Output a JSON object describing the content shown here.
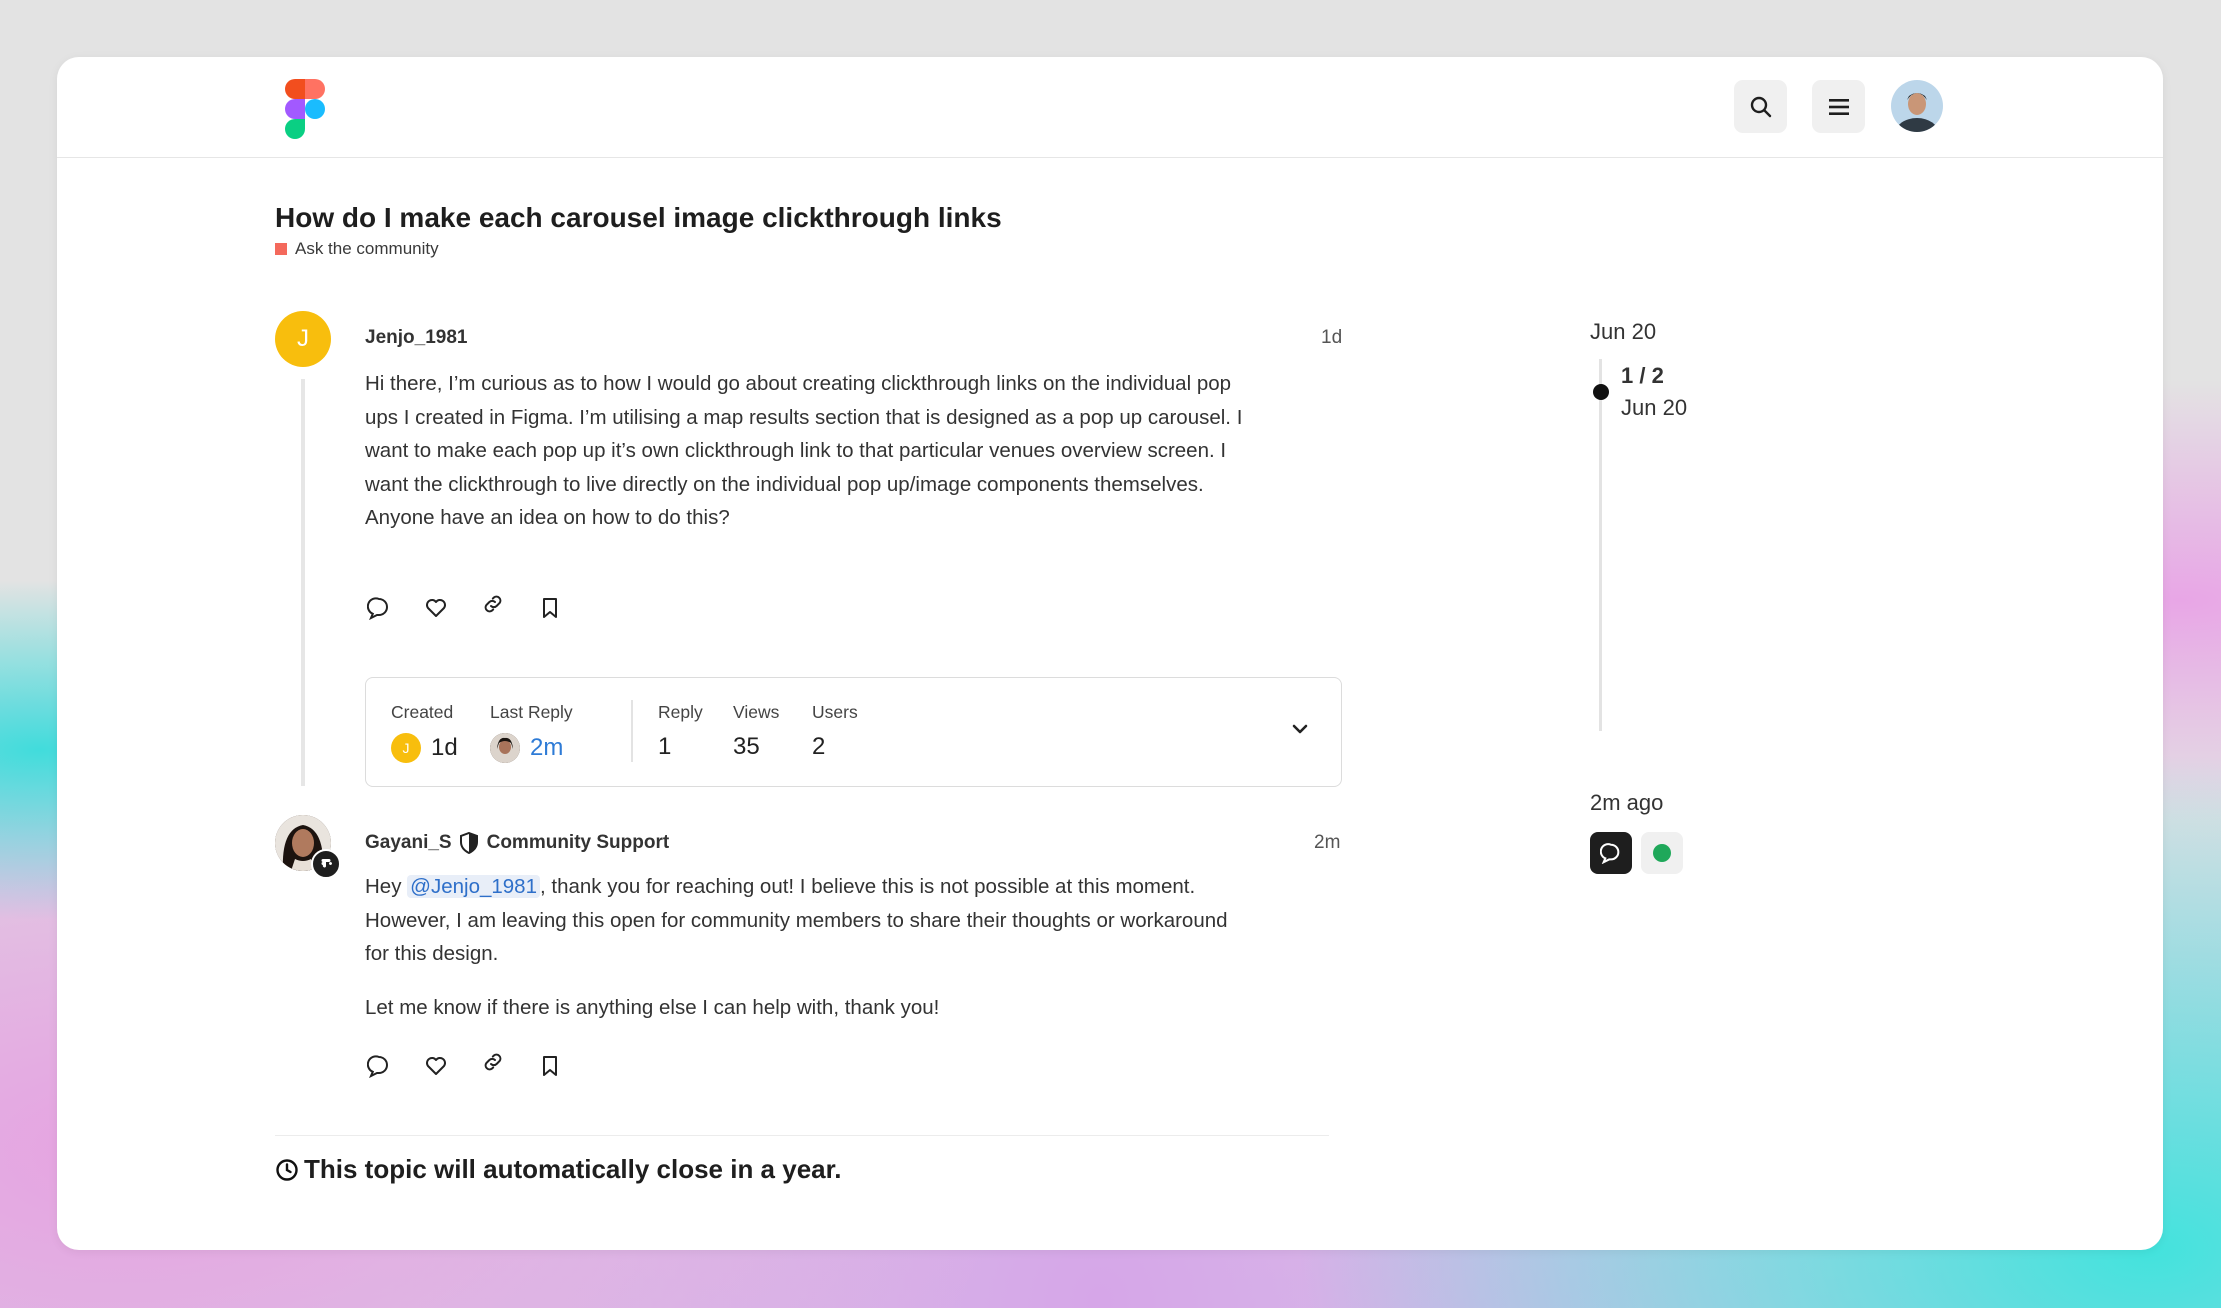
{
  "topic": {
    "title": "How do I make each carousel image clickthrough links",
    "category": "Ask the community",
    "category_color": "#f4695c"
  },
  "header": {
    "search_icon": "search-icon",
    "menu_icon": "hamburger-menu-icon"
  },
  "posts": [
    {
      "username": "Jenjo_1981",
      "avatar_letter": "J",
      "avatar_color": "#f8be0d",
      "date": "1d",
      "body": "Hi there, I’m curious as to how I would go about creating clickthrough links on the individual pop ups I created in Figma. I’m utilising a map results section that is designed as a pop up carousel. I want to make each pop up it’s own clickthrough link to that particular venues overview screen. I want the clickthrough to live directly on the individual pop up/image components themselves. Anyone have an idea on how to do this?"
    },
    {
      "username": "Gayani_S",
      "user_title": "Community Support",
      "date": "2m",
      "body_prefix": "Hey ",
      "mention": "@Jenjo_1981",
      "body_suffix": ", thank you for reaching out! I believe this is not possible at this moment. However, I am leaving this open for community members to share their thoughts or workaround for this design.",
      "body_2": "Let me know if there is anything else I can help with, thank you!"
    }
  ],
  "summary": {
    "created_label": "Created",
    "created_value": "1d",
    "created_avatar_letter": "J",
    "last_reply_label": "Last Reply",
    "last_reply_value": "2m",
    "reply_label": "Reply",
    "reply_value": "1",
    "views_label": "Views",
    "views_value": "35",
    "users_label": "Users",
    "users_value": "2"
  },
  "timeline": {
    "start_date": "Jun 20",
    "position": "1 / 2",
    "position_date": "Jun 20",
    "end_label": "2m ago"
  },
  "footer": {
    "close_notice": "This topic will automatically close in a year."
  },
  "colors": {
    "mention_blue": "#2e6fc9",
    "online_green": "#1fa85a"
  }
}
